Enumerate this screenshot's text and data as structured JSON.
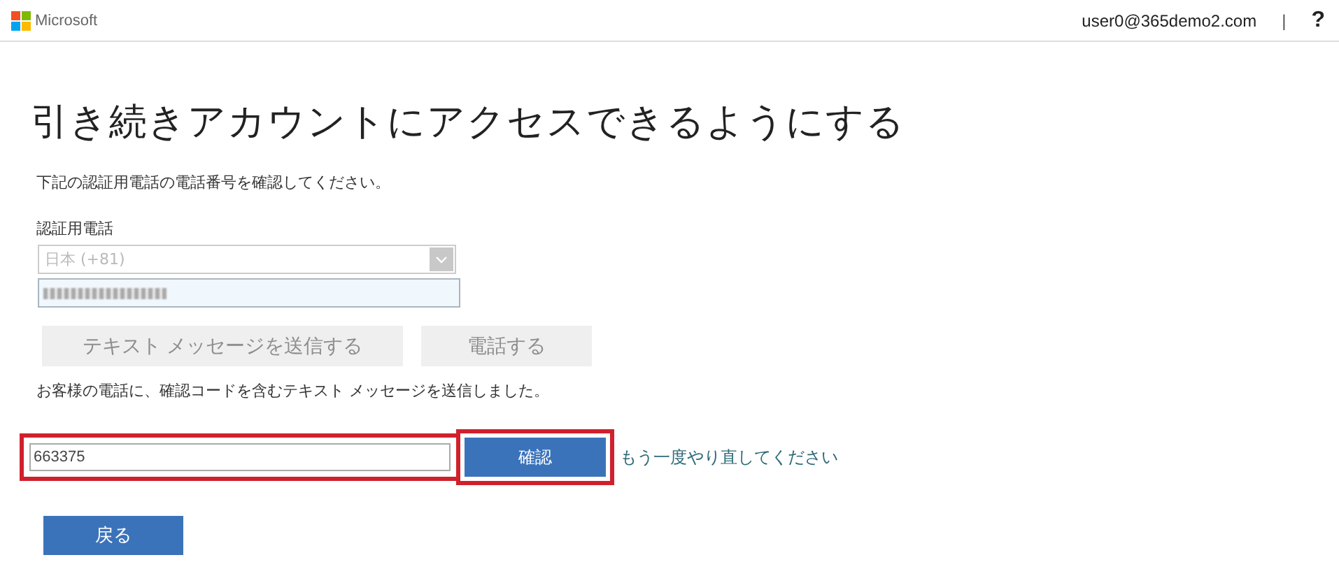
{
  "header": {
    "brand": "Microsoft",
    "user": "user0@365demo2.com",
    "separator": "|",
    "help": "?"
  },
  "title": "引き続きアカウントにアクセスできるようにする",
  "instruction": "下記の認証用電話の電話番号を確認してください。",
  "phone": {
    "label": "認証用電話",
    "country": "日本 (+81)",
    "country_disabled": true,
    "number_obscured": true
  },
  "send_buttons": [
    {
      "label": "テキスト メッセージを送信する",
      "disabled": true
    },
    {
      "label": "電話する",
      "disabled": true
    }
  ],
  "sent_message": "お客様の電話に、確認コードを含むテキスト メッセージを送信しました。",
  "code": {
    "value": "663375",
    "verify": "確認",
    "retry": "もう一度やり直してください",
    "highlighted": true
  },
  "back": "戻る"
}
